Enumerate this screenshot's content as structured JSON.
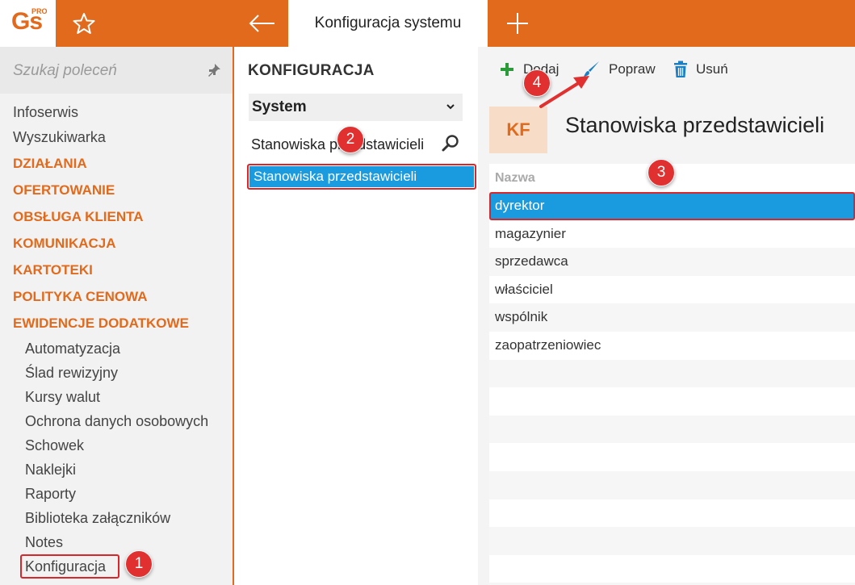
{
  "logo": {
    "main": "Gs",
    "sup": "PRO"
  },
  "header": {
    "active_tab": "Konfiguracja systemu"
  },
  "sidebar": {
    "search_placeholder": "Szukaj poleceń",
    "items": [
      "Infoserwis",
      "Wyszukiwarka"
    ],
    "sections": [
      "DZIAŁANIA",
      "OFERTOWANIE",
      "OBSŁUGA KLIENTA",
      "KOMUNIKACJA",
      "KARTOTEKI",
      "POLITYKA CENOWA",
      "EWIDENCJE DODATKOWE"
    ],
    "subitems": [
      "Automatyzacja",
      "Ślad rewizyjny",
      "Kursy walut",
      "Ochrona danych osobowych",
      "Schowek",
      "Naklejki",
      "Raporty",
      "Biblioteka załączników",
      "Notes",
      "Konfiguracja"
    ]
  },
  "middle": {
    "title": "KONFIGURACJA",
    "select_value": "System",
    "filter_value": "Stanowiska przedstawicieli",
    "result": "Stanowiska przedstawicieli"
  },
  "toolbar": {
    "add": "Dodaj",
    "edit": "Popraw",
    "delete": "Usuń"
  },
  "panel": {
    "badge": "KF",
    "title": "Stanowiska przedstawicieli",
    "column": "Nazwa",
    "rows": [
      "dyrektor",
      "magazynier",
      "sprzedawca",
      "właściciel",
      "wspólnik",
      "zaopatrzeniowiec"
    ]
  },
  "markers": [
    "1",
    "2",
    "3",
    "4"
  ],
  "colors": {
    "accent": "#e16a1c",
    "selection": "#1a9be0",
    "marker": "#e0302f"
  }
}
